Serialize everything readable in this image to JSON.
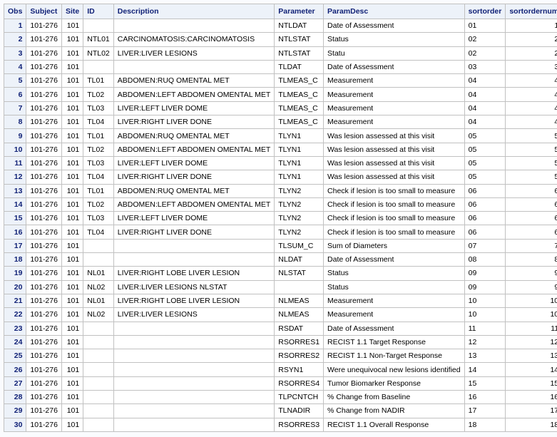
{
  "columns": [
    "Obs",
    "Subject",
    "Site",
    "ID",
    "Description",
    "Parameter",
    "ParamDesc",
    "sortorder",
    "sortordernum"
  ],
  "rows": [
    [
      "1",
      "101-276",
      "101",
      "",
      "",
      "NTLDAT",
      "Date of Assessment",
      "01",
      "1"
    ],
    [
      "2",
      "101-276",
      "101",
      "NTL01",
      "CARCINOMATOSIS:CARCINOMATOSIS",
      "NTLSTAT",
      "Status",
      "02",
      "2"
    ],
    [
      "3",
      "101-276",
      "101",
      "NTL02",
      "LIVER:LIVER LESIONS",
      "NTLSTAT",
      "Statu",
      "02",
      "2"
    ],
    [
      "4",
      "101-276",
      "101",
      "",
      "",
      "TLDAT",
      "Date of Assessment",
      "03",
      "3"
    ],
    [
      "5",
      "101-276",
      "101",
      "TL01",
      "ABDOMEN:RUQ OMENTAL MET",
      "TLMEAS_C",
      "Measurement",
      "04",
      "4"
    ],
    [
      "6",
      "101-276",
      "101",
      "TL02",
      "ABDOMEN:LEFT ABDOMEN OMENTAL MET",
      "TLMEAS_C",
      "Measurement",
      "04",
      "4"
    ],
    [
      "7",
      "101-276",
      "101",
      "TL03",
      "LIVER:LEFT LIVER DOME",
      "TLMEAS_C",
      "Measurement",
      "04",
      "4"
    ],
    [
      "8",
      "101-276",
      "101",
      "TL04",
      "LIVER:RIGHT LIVER DONE",
      "TLMEAS_C",
      "Measurement",
      "04",
      "4"
    ],
    [
      "9",
      "101-276",
      "101",
      "TL01",
      "ABDOMEN:RUQ OMENTAL MET",
      "TLYN1",
      "Was lesion assessed at this visit",
      "05",
      "5"
    ],
    [
      "10",
      "101-276",
      "101",
      "TL02",
      "ABDOMEN:LEFT ABDOMEN OMENTAL MET",
      "TLYN1",
      "Was lesion assessed at this visit",
      "05",
      "5"
    ],
    [
      "11",
      "101-276",
      "101",
      "TL03",
      "LIVER:LEFT LIVER DOME",
      "TLYN1",
      "Was lesion assessed at this visit",
      "05",
      "5"
    ],
    [
      "12",
      "101-276",
      "101",
      "TL04",
      "LIVER:RIGHT LIVER DONE",
      "TLYN1",
      "Was lesion assessed at this visit",
      "05",
      "5"
    ],
    [
      "13",
      "101-276",
      "101",
      "TL01",
      "ABDOMEN:RUQ OMENTAL MET",
      "TLYN2",
      "Check if lesion is too small to measure",
      "06",
      "6"
    ],
    [
      "14",
      "101-276",
      "101",
      "TL02",
      "ABDOMEN:LEFT ABDOMEN OMENTAL MET",
      "TLYN2",
      "Check if lesion is too small to measure",
      "06",
      "6"
    ],
    [
      "15",
      "101-276",
      "101",
      "TL03",
      "LIVER:LEFT LIVER DOME",
      "TLYN2",
      "Check if lesion is too small to measure",
      "06",
      "6"
    ],
    [
      "16",
      "101-276",
      "101",
      "TL04",
      "LIVER:RIGHT LIVER DONE",
      "TLYN2",
      "Check if lesion is too small to measure",
      "06",
      "6"
    ],
    [
      "17",
      "101-276",
      "101",
      "",
      "",
      "TLSUM_C",
      "Sum of Diameters",
      "07",
      "7"
    ],
    [
      "18",
      "101-276",
      "101",
      "",
      "",
      "NLDAT",
      "Date of Assessment",
      "08",
      "8"
    ],
    [
      "19",
      "101-276",
      "101",
      "NL01",
      "LIVER:RIGHT LOBE LIVER LESION",
      "NLSTAT",
      "Status",
      "09",
      "9"
    ],
    [
      "20",
      "101-276",
      "101",
      "NL02",
      "LIVER:LIVER LESIONS NLSTAT",
      "",
      "Status",
      "09",
      "9"
    ],
    [
      "21",
      "101-276",
      "101",
      "NL01",
      "LIVER:RIGHT LOBE LIVER LESION",
      "NLMEAS",
      "Measurement",
      "10",
      "10"
    ],
    [
      "22",
      "101-276",
      "101",
      "NL02",
      "LIVER:LIVER LESIONS",
      "NLMEAS",
      "Measurement",
      "10",
      "10"
    ],
    [
      "23",
      "101-276",
      "101",
      "",
      "",
      "RSDAT",
      "Date of Assessment",
      "11",
      "11"
    ],
    [
      "24",
      "101-276",
      "101",
      "",
      "",
      "RSORRES1",
      "RECIST 1.1 Target Response",
      "12",
      "12"
    ],
    [
      "25",
      "101-276",
      "101",
      "",
      "",
      "RSORRES2",
      "RECIST 1.1 Non-Target Response",
      "13",
      "13"
    ],
    [
      "26",
      "101-276",
      "101",
      "",
      "",
      "RSYN1",
      "Were unequivocal new lesions identified",
      "14",
      "14"
    ],
    [
      "27",
      "101-276",
      "101",
      "",
      "",
      "RSORRES4",
      "Tumor Biomarker Response",
      "15",
      "15"
    ],
    [
      "28",
      "101-276",
      "101",
      "",
      "",
      "TLPCNTCH",
      "% Change from Baseline",
      "16",
      "16"
    ],
    [
      "29",
      "101-276",
      "101",
      "",
      "",
      "TLNADIR",
      "% Change from NADIR",
      "17",
      "17"
    ],
    [
      "30",
      "101-276",
      "101",
      "",
      "",
      "RSORRES3",
      "RECIST 1.1 Overall Response",
      "18",
      "18"
    ]
  ]
}
